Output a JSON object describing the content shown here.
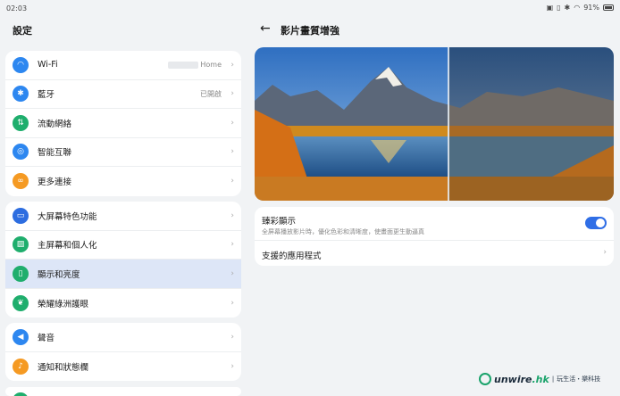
{
  "status_bar": {
    "time": "02:03",
    "battery": "91%"
  },
  "left_panel": {
    "title": "設定",
    "groups": [
      {
        "items": [
          {
            "label": "Wi-Fi",
            "value": "Home",
            "icon": "wifi-icon",
            "color": "#2d87f0"
          },
          {
            "label": "藍牙",
            "value": "已開啟",
            "icon": "bluetooth-icon",
            "color": "#2d87f0"
          },
          {
            "label": "流動網絡",
            "value": "",
            "icon": "mobile-data-icon",
            "color": "#1fae6d"
          },
          {
            "label": "智能互聯",
            "value": "",
            "icon": "smart-connect-icon",
            "color": "#2d87f0"
          },
          {
            "label": "更多連接",
            "value": "",
            "icon": "more-connections-icon",
            "color": "#f59a23"
          }
        ]
      },
      {
        "items": [
          {
            "label": "大屏幕特色功能",
            "icon": "large-screen-icon",
            "color": "#2d6de0"
          },
          {
            "label": "主屏幕和個人化",
            "icon": "home-screen-icon",
            "color": "#1fae6d"
          },
          {
            "label": "顯示和亮度",
            "icon": "display-icon",
            "color": "#1fae6d",
            "selected": true
          },
          {
            "label": "榮耀綠洲護眼",
            "icon": "eye-comfort-icon",
            "color": "#1fae6d"
          }
        ]
      },
      {
        "items": [
          {
            "label": "聲音",
            "icon": "sound-icon",
            "color": "#2d87f0"
          },
          {
            "label": "通知和狀態欄",
            "icon": "notification-icon",
            "color": "#f59a23"
          }
        ]
      }
    ]
  },
  "right_panel": {
    "title": "影片畫質增強",
    "vivid": {
      "title": "臻彩顯示",
      "subtitle": "全屏幕播放影片時，優化色彩和清晰度，使畫面更生動逼真",
      "enabled": true
    },
    "supported_apps": "支援的應用程式"
  },
  "watermark": {
    "brand_left": "unwire",
    "brand_right": ".hk",
    "tagline": "玩生活・樂科技"
  }
}
